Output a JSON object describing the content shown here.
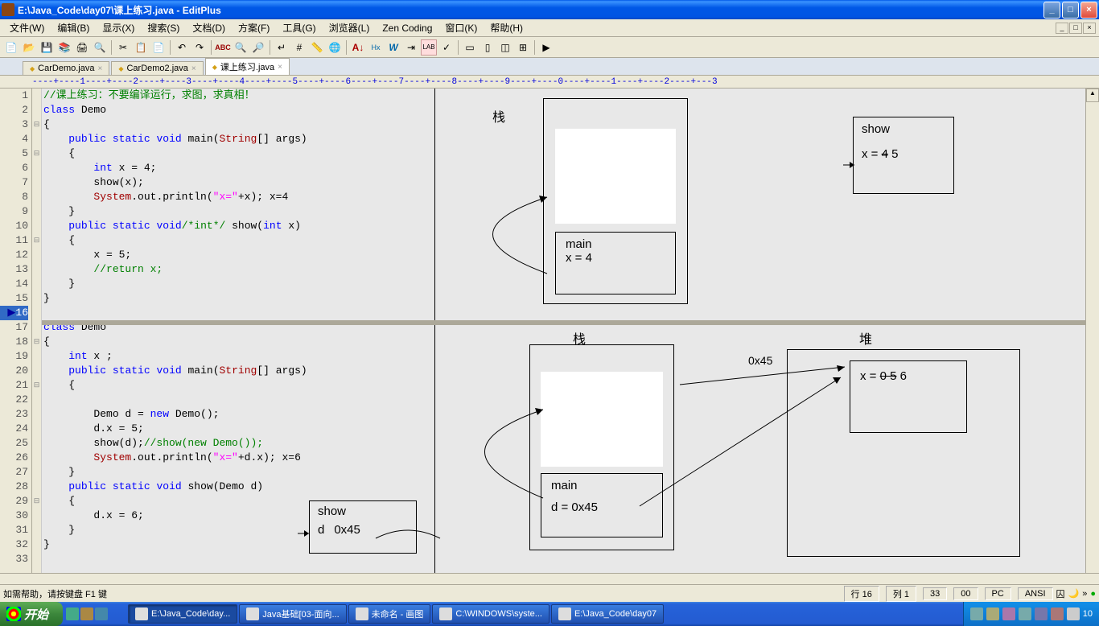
{
  "title": "E:\\Java_Code\\day07\\课上练习.java - EditPlus",
  "menus": [
    "文件(W)",
    "编辑(B)",
    "显示(X)",
    "搜索(S)",
    "文档(D)",
    "方案(F)",
    "工具(G)",
    "浏览器(L)",
    "Zen Coding",
    "窗口(K)",
    "帮助(H)"
  ],
  "tabs": [
    {
      "name": "CarDemo.java",
      "active": false
    },
    {
      "name": "CarDemo2.java",
      "active": false
    },
    {
      "name": "课上练习.java",
      "active": true
    }
  ],
  "ruler": "----+----1----+----2----+----3----+----4----+----5----+----6----+----7----+----8----+----9----+----0----+----1----+----2----+---3",
  "code_lines": [
    {
      "n": "1",
      "fold": "",
      "html": "<span class='cmt'>//课上练习：不要编译运行，求图，求真相！</span>"
    },
    {
      "n": "2",
      "fold": "",
      "html": "<span class='kw'>class</span> Demo"
    },
    {
      "n": "3",
      "fold": "⊟",
      "html": "{"
    },
    {
      "n": "4",
      "fold": "",
      "html": "    <span class='kw'>public</span> <span class='kw'>static</span> <span class='kw'>void</span> main(<span class='cls'>String</span>[] args)"
    },
    {
      "n": "5",
      "fold": "⊟",
      "html": "    {"
    },
    {
      "n": "6",
      "fold": "",
      "html": "        <span class='kw'>int</span> x = 4;"
    },
    {
      "n": "7",
      "fold": "",
      "html": "        show(x);"
    },
    {
      "n": "8",
      "fold": "",
      "html": "        <span class='cls'>System</span>.out.println(<span class='str'>\"x=\"</span>+x); x=4"
    },
    {
      "n": "9",
      "fold": "",
      "html": "    }"
    },
    {
      "n": "10",
      "fold": "",
      "html": "    <span class='kw'>public</span> <span class='kw'>static</span> <span class='kw'>void</span><span class='cmt'>/*int*/</span> show(<span class='kw'>int</span> x)"
    },
    {
      "n": "11",
      "fold": "⊟",
      "html": "    {"
    },
    {
      "n": "12",
      "fold": "",
      "html": "        x = 5;"
    },
    {
      "n": "13",
      "fold": "",
      "html": "        <span class='cmt'>//return x;</span>"
    },
    {
      "n": "14",
      "fold": "",
      "html": "    }"
    },
    {
      "n": "15",
      "fold": "",
      "html": "}"
    },
    {
      "n": "16",
      "fold": "",
      "html": "",
      "current": true,
      "arrow": "▶"
    },
    {
      "n": "17",
      "fold": "",
      "html": "<span class='kw'>class</span> Demo"
    },
    {
      "n": "18",
      "fold": "⊟",
      "html": "{"
    },
    {
      "n": "19",
      "fold": "",
      "html": "    <span class='kw'>int</span> x ;"
    },
    {
      "n": "20",
      "fold": "",
      "html": "    <span class='kw'>public</span> <span class='kw'>static</span> <span class='kw'>void</span> main(<span class='cls'>String</span>[] args)"
    },
    {
      "n": "21",
      "fold": "⊟",
      "html": "    {"
    },
    {
      "n": "22",
      "fold": "",
      "html": ""
    },
    {
      "n": "23",
      "fold": "",
      "html": "        Demo d = <span class='kw'>new</span> Demo();"
    },
    {
      "n": "24",
      "fold": "",
      "html": "        d.x = 5;"
    },
    {
      "n": "25",
      "fold": "",
      "html": "        show(d);<span class='cmt'>//show(new Demo());</span>"
    },
    {
      "n": "26",
      "fold": "",
      "html": "        <span class='cls'>System</span>.out.println(<span class='str'>\"x=\"</span>+d.x); x=6"
    },
    {
      "n": "27",
      "fold": "",
      "html": "    }"
    },
    {
      "n": "28",
      "fold": "",
      "html": "    <span class='kw'>public</span> <span class='kw'>static</span> <span class='kw'>void</span> show(Demo d)"
    },
    {
      "n": "29",
      "fold": "⊟",
      "html": "    {"
    },
    {
      "n": "30",
      "fold": "",
      "html": "        d.x = 6;"
    },
    {
      "n": "31",
      "fold": "",
      "html": "    }"
    },
    {
      "n": "32",
      "fold": "",
      "html": "}"
    },
    {
      "n": "33",
      "fold": "",
      "html": ""
    }
  ],
  "diagram": {
    "stack1_label": "栈",
    "main1_title": "main",
    "main1_var": "x = 4",
    "show1_title": "show",
    "show1_var_prefix": "x = ",
    "show1_var_old": "4",
    "show1_var_new": " 5",
    "stack2_label": "栈",
    "heap2_label": "堆",
    "main2_title": "main",
    "main2_var": "d = 0x45",
    "addr": "0x45",
    "heap_prefix": "x = ",
    "heap_old1": "0",
    "heap_old2": " 5",
    "heap_new": " 6",
    "show2_title": "show",
    "show2_d": "d",
    "show2_addr": "0x45"
  },
  "status": {
    "help": "如需帮助，请按键盘 F1 键",
    "line_label": "行",
    "line": "16",
    "col_label": "列",
    "col": "1",
    "total": "33",
    "binary": "00",
    "os": "PC",
    "enc": "ANSI"
  },
  "taskbar": {
    "start": "开始",
    "items": [
      {
        "label": "E:\\Java_Code\\day...",
        "active": true
      },
      {
        "label": "Java基础[03-面向...",
        "active": false
      },
      {
        "label": "未命名 - 画图",
        "active": false
      },
      {
        "label": "C:\\WINDOWS\\syste...",
        "active": false
      },
      {
        "label": "E:\\Java_Code\\day07",
        "active": false
      }
    ],
    "time": "10"
  }
}
